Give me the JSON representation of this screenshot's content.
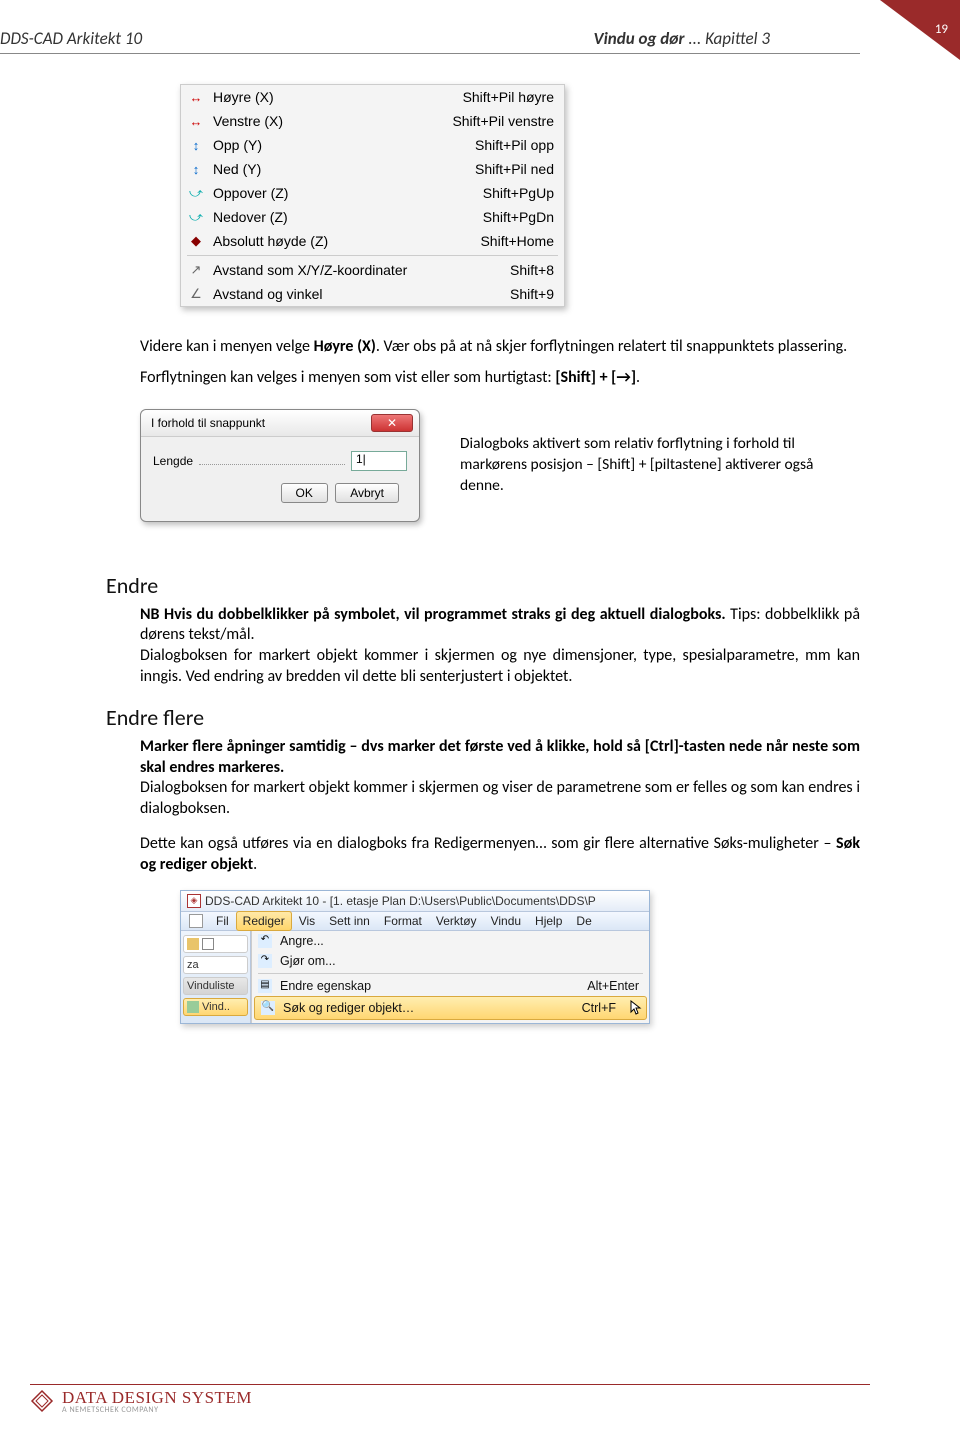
{
  "page_number": "19",
  "header": {
    "left": "DDS-CAD Arkitekt 10",
    "right_bold": "Vindu og dør",
    "right_plain": " ... Kapittel 3"
  },
  "menu": {
    "rows": [
      {
        "icon": "↔",
        "icon_class": "ic-red",
        "label": "Høyre (X)",
        "shortcut": "Shift+Pil høyre"
      },
      {
        "icon": "↔",
        "icon_class": "ic-red",
        "label": "Venstre (X)",
        "shortcut": "Shift+Pil venstre"
      },
      {
        "icon": "↕",
        "icon_class": "ic-blue",
        "label": "Opp (Y)",
        "shortcut": "Shift+Pil opp"
      },
      {
        "icon": "↕",
        "icon_class": "ic-blue",
        "label": "Ned (Y)",
        "shortcut": "Shift+Pil ned"
      },
      {
        "icon": "⤻",
        "icon_class": "ic-cyan",
        "label": "Oppover (Z)",
        "shortcut": "Shift+PgUp"
      },
      {
        "icon": "⤻",
        "icon_class": "ic-cyan",
        "label": "Nedover (Z)",
        "shortcut": "Shift+PgDn"
      },
      {
        "icon": "◆",
        "icon_class": "ic-dkred",
        "label": "Absolutt høyde (Z)",
        "shortcut": "Shift+Home"
      }
    ],
    "rows2": [
      {
        "icon": "↗",
        "icon_class": "ic-gray",
        "label": "Avstand som X/Y/Z-koordinater",
        "shortcut": "Shift+8"
      },
      {
        "icon": "∠",
        "icon_class": "ic-gray",
        "label": "Avstand og vinkel",
        "shortcut": "Shift+9"
      }
    ]
  },
  "para1_a": "Videre kan i menyen velge ",
  "para1_b": "Høyre (X)",
  "para1_c": ". Vær obs på at nå skjer forflytningen relatert til snappunktets plassering.",
  "para2_a": "Forflytningen kan velges i menyen som vist eller som hurtigtast:  ",
  "para2_b": "[Shift] + [→]",
  "para2_c": ".",
  "dialog": {
    "title": "I forhold til snappunkt",
    "field_label": "Lengde",
    "field_value": "1|",
    "ok": "OK",
    "cancel": "Avbryt"
  },
  "dialog_caption": "Dialogboks aktivert som relativ forflytning i forhold til markørens posisjon – [Shift] + [piltastene] aktiverer også denne.",
  "section1_title": "Endre",
  "section1_body_a": "NB Hvis du dobbelklikker på symbolet, vil programmet straks gi deg aktuell dialogboks.",
  "section1_body_b": " Tips: dobbelklikk på dørens tekst/mål.",
  "section1_body_c": "Dialogboksen for markert objekt kommer i skjermen og nye dimensjoner, type, spesialparametre, mm kan inngis. Ved endring av bredden vil dette bli senterjustert i objektet.",
  "section2_title": "Endre flere",
  "section2_body_a": "Marker flere åpninger samtidig – dvs marker det første ved å klikke, hold så [Ctrl]-tasten nede når neste som skal endres markeres.",
  "section2_body_b": "Dialogboksen for markert objekt kommer i skjermen og viser de parametrene som er felles og som kan endres i dialogboksen.",
  "section2_body_c_a": "Dette kan også utføres via en dialogboks fra Redigermenyen… som gir flere alternative Søks-muligheter – ",
  "section2_body_c_b": "Søk og rediger objekt",
  "section2_body_c_c": ".",
  "editor": {
    "title": "DDS-CAD Arkitekt 10 - [1. etasje  Plan  D:\\Users\\Public\\Documents\\DDS\\P",
    "menubar": [
      "Fil",
      "Rediger",
      "Vis",
      "Sett inn",
      "Format",
      "Verktøy",
      "Vindu",
      "Hjelp",
      "De"
    ],
    "side": [
      {
        "label": "za",
        "sel": false
      },
      {
        "label": "Vinduliste",
        "sel": false,
        "truncated": true
      },
      {
        "label": "Vind..",
        "sel": true
      }
    ],
    "dropdown": [
      {
        "icon": "↶",
        "label": "Angre...",
        "shortcut": "",
        "hl": false
      },
      {
        "icon": "↷",
        "label": "Gjør om...",
        "shortcut": "",
        "hl": false
      },
      {
        "sep": true
      },
      {
        "icon": "▤",
        "label": "Endre egenskap",
        "shortcut": "Alt+Enter",
        "hl": false
      },
      {
        "icon": "🔍",
        "label": "Søk og rediger objekt…",
        "shortcut": "Ctrl+F",
        "hl": true
      }
    ]
  },
  "footer": {
    "main": "DATA DESIGN SYSTEM",
    "sub": "A NEMETSCHEK COMPANY"
  }
}
